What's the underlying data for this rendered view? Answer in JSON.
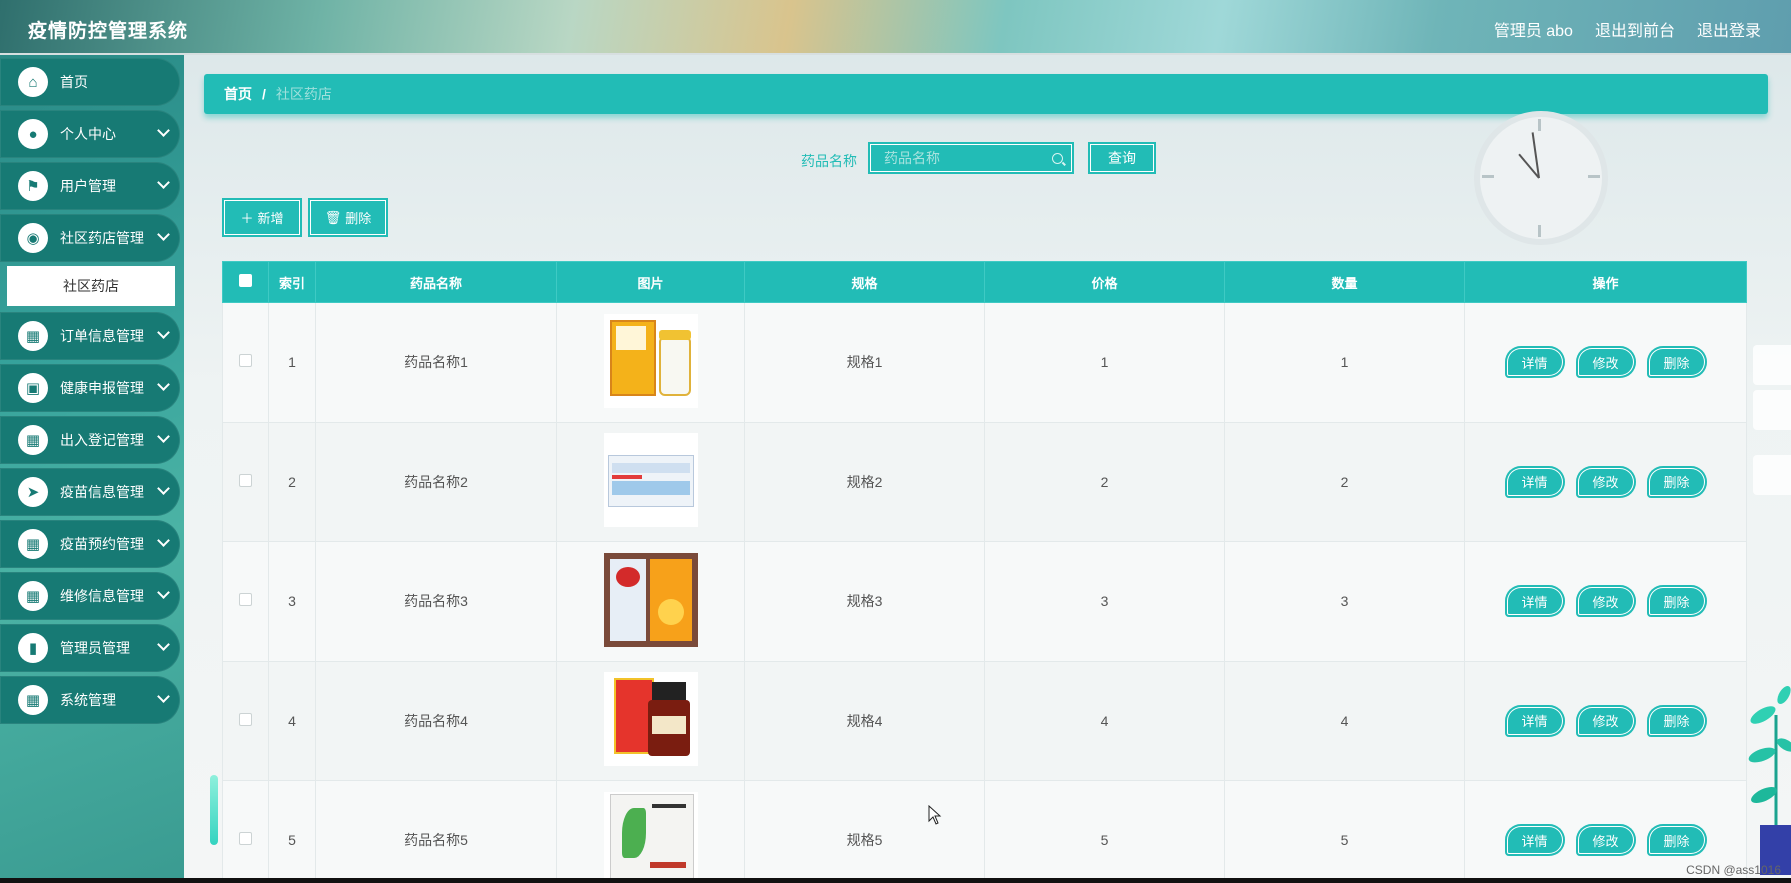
{
  "header": {
    "title": "疫情防控管理系统",
    "links": [
      "管理员 abo",
      "退出到前台",
      "退出登录"
    ]
  },
  "sidebar": {
    "items": [
      {
        "label": "首页",
        "icon": "home-icon",
        "glyph": "⌂",
        "has_children": false
      },
      {
        "label": "个人中心",
        "icon": "person-icon",
        "glyph": "●",
        "has_children": true
      },
      {
        "label": "用户管理",
        "icon": "flag-icon",
        "glyph": "⚑",
        "has_children": true
      },
      {
        "label": "社区药店管理",
        "icon": "pin-icon",
        "glyph": "◉",
        "has_children": true
      },
      {
        "label": "订单信息管理",
        "icon": "grid-icon",
        "glyph": "▦",
        "has_children": true
      },
      {
        "label": "健康申报管理",
        "icon": "clipboard-icon",
        "glyph": "▣",
        "has_children": true
      },
      {
        "label": "出入登记管理",
        "icon": "grid-icon",
        "glyph": "▦",
        "has_children": true
      },
      {
        "label": "疫苗信息管理",
        "icon": "send-icon",
        "glyph": "➤",
        "has_children": true
      },
      {
        "label": "疫苗预约管理",
        "icon": "grid-icon",
        "glyph": "▦",
        "has_children": true
      },
      {
        "label": "维修信息管理",
        "icon": "grid-icon",
        "glyph": "▦",
        "has_children": true
      },
      {
        "label": "管理员管理",
        "icon": "chart-icon",
        "glyph": "▮",
        "has_children": true
      },
      {
        "label": "系统管理",
        "icon": "grid-icon",
        "glyph": "▦",
        "has_children": true
      }
    ],
    "submenu": {
      "parent_index": 3,
      "label": "社区药店"
    }
  },
  "breadcrumb": {
    "home": "首页",
    "separator": "/",
    "current": "社区药店"
  },
  "search": {
    "label": "药品名称",
    "placeholder": "药品名称",
    "value": "",
    "button": "查询"
  },
  "actions": {
    "add": "新增",
    "delete": "删除"
  },
  "table": {
    "columns": [
      "",
      "索引",
      "药品名称",
      "图片",
      "规格",
      "价格",
      "数量",
      "操作"
    ],
    "rows": [
      {
        "index": "1",
        "name": "药品名称1",
        "spec": "规格1",
        "price": "1",
        "qty": "1"
      },
      {
        "index": "2",
        "name": "药品名称2",
        "spec": "规格2",
        "price": "2",
        "qty": "2"
      },
      {
        "index": "3",
        "name": "药品名称3",
        "spec": "规格3",
        "price": "3",
        "qty": "3"
      },
      {
        "index": "4",
        "name": "药品名称4",
        "spec": "规格4",
        "price": "4",
        "qty": "4"
      },
      {
        "index": "5",
        "name": "药品名称5",
        "spec": "规格5",
        "price": "5",
        "qty": "5"
      }
    ],
    "row_actions": [
      "详情",
      "修改",
      "删除"
    ]
  },
  "colors": {
    "accent": "#22bcb6",
    "sidebar_item": "#177a74"
  },
  "watermark": "CSDN @ass1016"
}
